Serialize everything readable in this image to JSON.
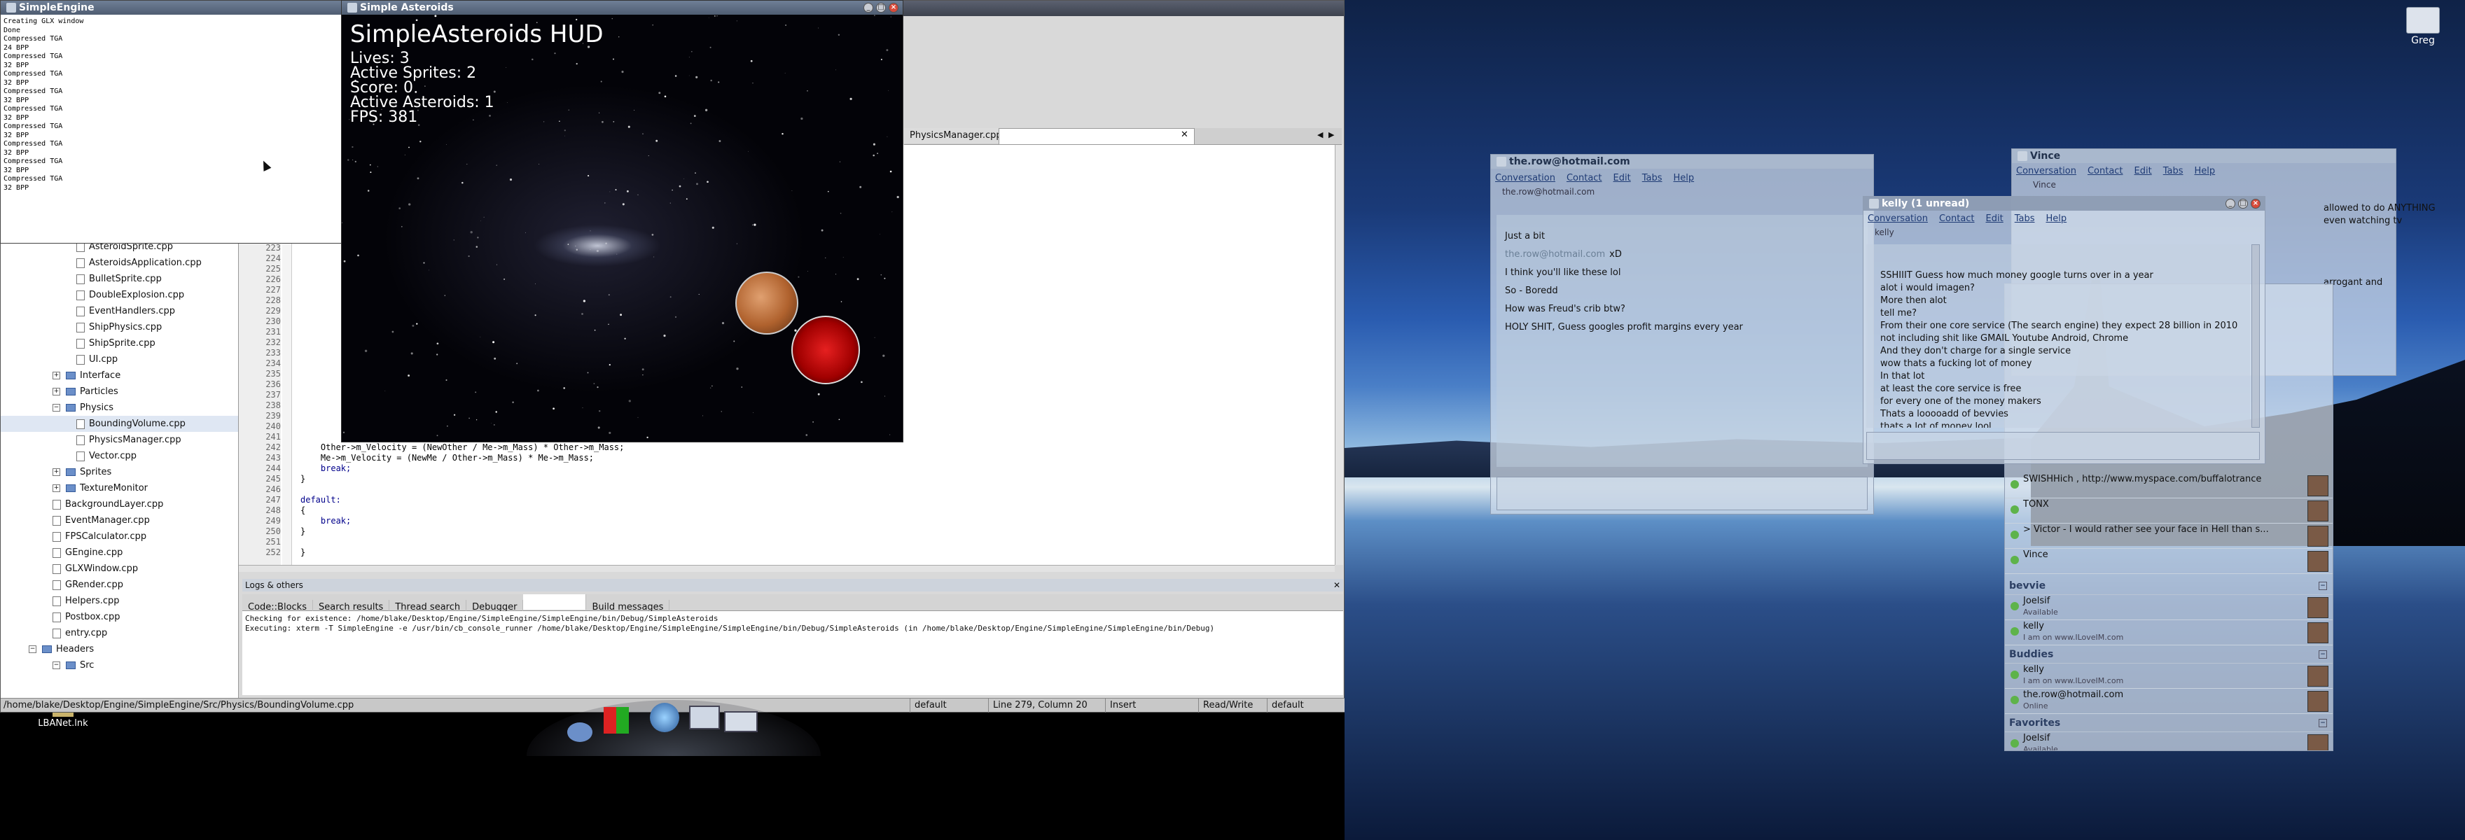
{
  "simple_engine_console": {
    "title": "SimpleEngine",
    "lines": [
      "Creating GLX window",
      "Done",
      "Compressed TGA",
      "24 BPP",
      "Compressed TGA",
      "32 BPP",
      "Compressed TGA",
      "32 BPP",
      "Compressed TGA",
      "32 BPP",
      "Compressed TGA",
      "32 BPP",
      "Compressed TGA",
      "32 BPP",
      "Compressed TGA",
      "32 BPP",
      "Compressed TGA",
      "32 BPP",
      "Compressed TGA",
      "32 BPP"
    ]
  },
  "game_window": {
    "title": "Simple Asteroids",
    "hud_title": "SimpleAsteroids HUD",
    "stats": [
      "Lives: 3",
      "Active Sprites: 2",
      "Score: 0",
      "Active Asteroids: 1",
      "FPS: 381"
    ]
  },
  "ide": {
    "open_tab": "PhysicsManager.cpp",
    "tree": [
      {
        "label": "AsteroidSprite.cpp",
        "type": "file",
        "indent": 2
      },
      {
        "label": "AsteroidsApplication.cpp",
        "type": "file",
        "indent": 2
      },
      {
        "label": "BulletSprite.cpp",
        "type": "file",
        "indent": 2
      },
      {
        "label": "DoubleExplosion.cpp",
        "type": "file",
        "indent": 2
      },
      {
        "label": "EventHandlers.cpp",
        "type": "file",
        "indent": 2
      },
      {
        "label": "ShipPhysics.cpp",
        "type": "file",
        "indent": 2
      },
      {
        "label": "ShipSprite.cpp",
        "type": "file",
        "indent": 2
      },
      {
        "label": "UI.cpp",
        "type": "file",
        "indent": 2
      },
      {
        "label": "Interface",
        "type": "folder",
        "indent": 1,
        "exp": "+"
      },
      {
        "label": "Particles",
        "type": "folder",
        "indent": 1,
        "exp": "+"
      },
      {
        "label": "Physics",
        "type": "folder",
        "indent": 1,
        "exp": "−"
      },
      {
        "label": "BoundingVolume.cpp",
        "type": "file",
        "indent": 2,
        "selected": true
      },
      {
        "label": "PhysicsManager.cpp",
        "type": "file",
        "indent": 2
      },
      {
        "label": "Vector.cpp",
        "type": "file",
        "indent": 2
      },
      {
        "label": "Sprites",
        "type": "folder",
        "indent": 1,
        "exp": "+"
      },
      {
        "label": "TextureMonitor",
        "type": "folder",
        "indent": 1,
        "exp": "+"
      },
      {
        "label": "BackgroundLayer.cpp",
        "type": "file",
        "indent": 1
      },
      {
        "label": "EventManager.cpp",
        "type": "file",
        "indent": 1
      },
      {
        "label": "FPSCalculator.cpp",
        "type": "file",
        "indent": 1
      },
      {
        "label": "GEngine.cpp",
        "type": "file",
        "indent": 1
      },
      {
        "label": "GLXWindow.cpp",
        "type": "file",
        "indent": 1
      },
      {
        "label": "GRender.cpp",
        "type": "file",
        "indent": 1
      },
      {
        "label": "Helpers.cpp",
        "type": "file",
        "indent": 1
      },
      {
        "label": "Postbox.cpp",
        "type": "file",
        "indent": 1
      },
      {
        "label": "entry.cpp",
        "type": "file",
        "indent": 1
      },
      {
        "label": "Headers",
        "type": "folder",
        "indent": 0,
        "exp": "−"
      },
      {
        "label": "Src",
        "type": "folder",
        "indent": 1,
        "exp": "−"
      }
    ],
    "line_numbers": [
      "223",
      "224",
      "225",
      "226",
      "227",
      "228",
      "229",
      "230",
      "231",
      "232",
      "233",
      "234",
      "235",
      "236",
      "237",
      "238",
      "239",
      "240",
      "241",
      "242",
      "243",
      "244",
      "245",
      "246",
      "247",
      "248",
      "249",
      "250",
      "251",
      "252"
    ],
    "code_lines": [
      "",
      "",
      "",
      "",
      "",
      "",
      "",
      "",
      "",
      "",
      "",
      "",
      "",
      "",
      "",
      "",
      "",
      "",
      "",
      "    Other->m_Velocity = (NewOther / Me->m_Mass) * Other->m_Mass;",
      "    Me->m_Velocity = (NewMe / Other->m_Mass) * Me->m_Mass;",
      "    break;",
      "}",
      "",
      "default:",
      "{",
      "    break;",
      "}",
      "",
      "}"
    ],
    "logs_title": "Logs & others",
    "log_tabs": [
      "Code::Blocks",
      "Search results",
      "Thread search",
      "Debugger",
      "",
      "Build messages"
    ],
    "log_lines": [
      "Checking for existence: /home/blake/Desktop/Engine/SimpleEngine/SimpleEngine/bin/Debug/SimpleAsteroids",
      "Executing: xterm -T SimpleEngine -e /usr/bin/cb_console_runner /home/blake/Desktop/Engine/SimpleEngine/SimpleEngine/bin/Debug/SimpleAsteroids  (in /home/blake/Desktop/Engine/SimpleEngine/SimpleEngine/bin/Debug)"
    ],
    "status": {
      "path": "/home/blake/Desktop/Engine/SimpleEngine/Src/Physics/BoundingVolume.cpp",
      "encoding": "default",
      "position": "Line 279, Column 20",
      "mode": "Insert",
      "access": "Read/Write",
      "lang": "default"
    }
  },
  "desktop": {
    "shortcut_label": "LBANet.lnk",
    "home_folder_label": "Greg"
  },
  "chat_row": {
    "title": "the.row@hotmail.com",
    "menu": [
      "Conversation",
      "Contact",
      "Edit",
      "Tabs",
      "Help"
    ],
    "contact_line": "the.row@hotmail.com",
    "lines": [
      {
        "who": "",
        "text": "Just a bit"
      },
      {
        "who": "the.row@hotmail.com",
        "text": "xD"
      },
      {
        "who": "",
        "text": "I think you'll like these lol"
      },
      {
        "who": "",
        "text": "So - Boredd"
      },
      {
        "who": "",
        "text": "How was Freud's crib btw?"
      },
      {
        "who": "",
        "text": "HOLY SHIT, Guess googles profit margins every year"
      }
    ]
  },
  "chat_kelly": {
    "title": "kelly (1 unread)",
    "menu": [
      "Conversation",
      "Contact",
      "Edit",
      "Tabs",
      "Help"
    ],
    "contact_line": "kelly",
    "lines": [
      "SSHIIIT Guess how much money google turns over in a year",
      "alot i would imagen?",
      "More then alot",
      "tell me?",
      "From their one core service (The search engine) they expect 28 billion in 2010",
      "not including shit like GMAIL Youtube Android, Chrome",
      "And they don't charge for a single service",
      "wow thats a fucking lot of money",
      "In that lot",
      "at least the core service is free",
      "for every one of the money makers",
      "Thats a looooadd of bevvies",
      "thats a lot of money lool"
    ]
  },
  "chat_vince": {
    "title": "Vince",
    "menu": [
      "Conversation",
      "Contact",
      "Edit",
      "Tabs",
      "Help"
    ],
    "contact_line": "Vince",
    "lines": [
      "allowed to do ANYTHING",
      "even watching tv",
      "arrogant and"
    ]
  },
  "buddy_list": {
    "top_items": [
      {
        "name": "SWISHHich , http://www.myspace.com/buffalotrance",
        "status": ""
      },
      {
        "name": "TONX",
        "status": ""
      },
      {
        "name": "> Victor - I would rather see your face in Hell than s...",
        "status": ""
      },
      {
        "name": "Vince",
        "status": ""
      }
    ],
    "groups": [
      {
        "name": "bevvie",
        "items": [
          {
            "name": "Joelsif",
            "status": "Available"
          },
          {
            "name": "kelly",
            "status": "I am on www.ILoveIM.com"
          }
        ]
      },
      {
        "name": "Buddies",
        "items": [
          {
            "name": "kelly",
            "status": "I am on www.ILoveIM.com"
          },
          {
            "name": "the.row@hotmail.com",
            "status": "Online"
          }
        ]
      },
      {
        "name": "Favorites",
        "items": [
          {
            "name": "Joelsif",
            "status": "Available"
          }
        ]
      }
    ]
  }
}
